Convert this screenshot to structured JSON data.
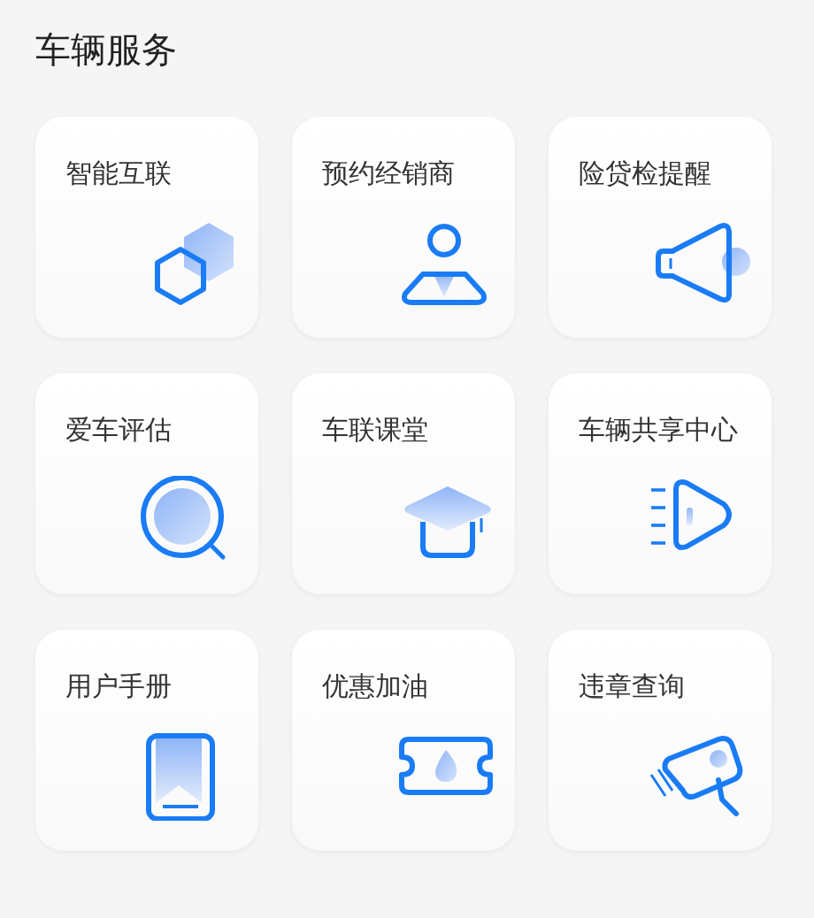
{
  "section": {
    "title": "车辆服务"
  },
  "services": [
    {
      "label": "智能互联",
      "kind": "hexagons"
    },
    {
      "label": "预约经销商",
      "kind": "person"
    },
    {
      "label": "险贷检提醒",
      "kind": "speaker"
    },
    {
      "label": "爱车评估",
      "kind": "magnifier"
    },
    {
      "label": "车联课堂",
      "kind": "mortarboard"
    },
    {
      "label": "车辆共享中心",
      "kind": "headlight"
    },
    {
      "label": "用户手册",
      "kind": "book"
    },
    {
      "label": "优惠加油",
      "kind": "ticket"
    },
    {
      "label": "违章查询",
      "kind": "camera"
    }
  ]
}
